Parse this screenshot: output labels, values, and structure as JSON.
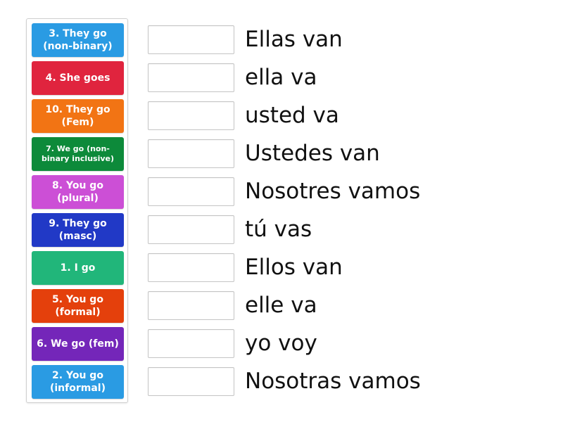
{
  "tiles": [
    {
      "label": "3. They go (non-binary)",
      "color": "#2a9be3"
    },
    {
      "label": "4. She goes",
      "color": "#e0243e"
    },
    {
      "label": "10. They go (Fem)",
      "color": "#f27414"
    },
    {
      "label": "7. We go (non-binary inclusive)",
      "color": "#0d8a3a"
    },
    {
      "label": "8. You go (plural)",
      "color": "#cc4fd6"
    },
    {
      "label": "9. They go (masc)",
      "color": "#2139c6"
    },
    {
      "label": "1. I go",
      "color": "#21b67a"
    },
    {
      "label": "5. You go (formal)",
      "color": "#e4400c"
    },
    {
      "label": "6. We go (fem)",
      "color": "#7426b9"
    },
    {
      "label": "2. You go (informal)",
      "color": "#2a9be3"
    }
  ],
  "answers": [
    "Ellas van",
    "ella va",
    "usted va",
    "Ustedes van",
    "Nosotres vamos",
    "tú vas",
    "Ellos van",
    "elle va",
    "yo voy",
    "Nosotras vamos"
  ]
}
